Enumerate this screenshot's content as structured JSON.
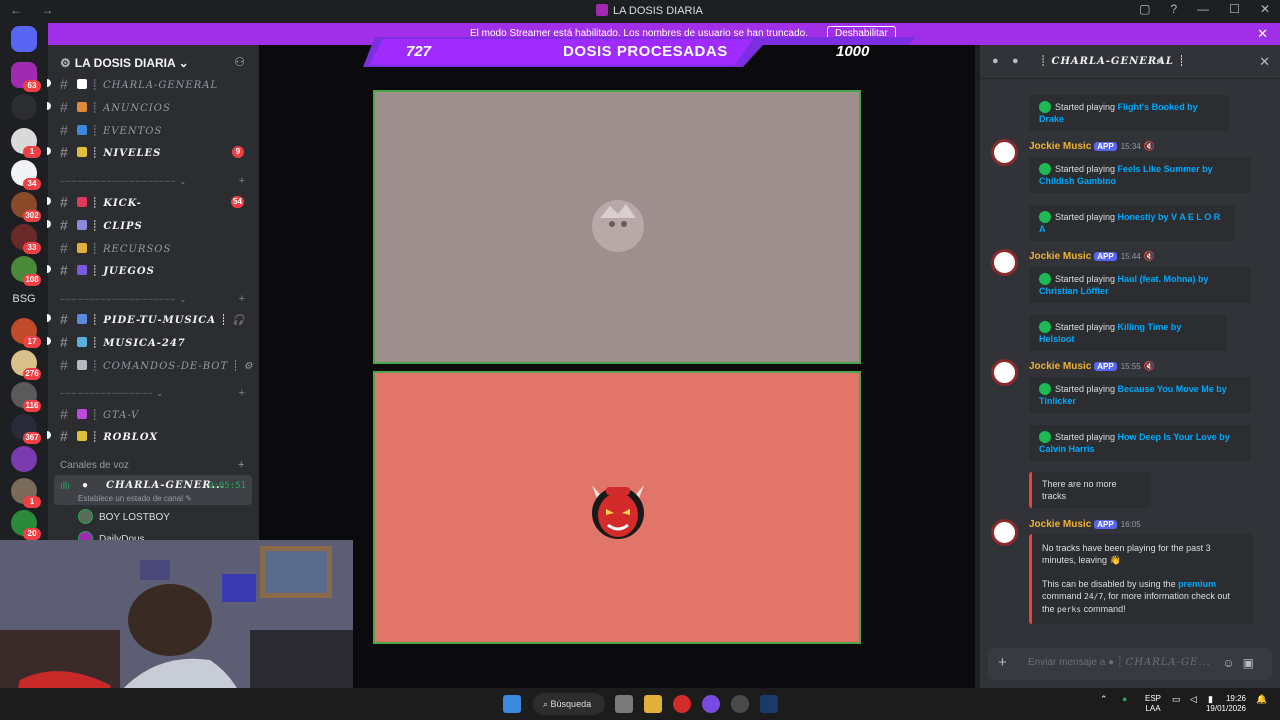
{
  "window": {
    "title": "LA DOSIS DIARIA",
    "nav": "← →",
    "controls": [
      "▢",
      "?",
      "—",
      "☐",
      "✕"
    ]
  },
  "banner": {
    "text": "El modo Streamer está habilitado. Los nombres de usuario se han truncado.",
    "button": "Deshabilitar",
    "close": "✕"
  },
  "servers": [
    {
      "badge": "63"
    },
    {
      "badge": ""
    },
    {
      "badge": "1"
    },
    {
      "badge": "34"
    },
    {
      "badge": "302"
    },
    {
      "badge": "33"
    },
    {
      "badge": "108"
    },
    {
      "label": "BSG"
    },
    {
      "badge": "17"
    },
    {
      "badge": "276"
    },
    {
      "badge": "116"
    },
    {
      "badge": "367"
    },
    {
      "badge": ""
    },
    {
      "badge": "1"
    },
    {
      "badge": "20"
    }
  ],
  "sidebar": {
    "server_name": "LA DOSIS DIARIA",
    "channels": [
      {
        "label": "CHARLA-GENERAL",
        "bold": false,
        "count": ""
      },
      {
        "label": "ANUNCIOS",
        "bold": false,
        "count": ""
      },
      {
        "label": "EVENTOS",
        "bold": false,
        "count": ""
      },
      {
        "label": "NIVELES",
        "bold": true,
        "count": "9"
      },
      {
        "label": "KICK-",
        "bold": true,
        "count": "54"
      },
      {
        "label": "CLIPS",
        "bold": true,
        "count": ""
      },
      {
        "label": "RECURSOS",
        "bold": false,
        "count": ""
      },
      {
        "label": "JUEGOS",
        "bold": true,
        "count": ""
      },
      {
        "label": "PIDE-TU-MUSICA",
        "bold": true,
        "count": ""
      },
      {
        "label": "MUSICA-247",
        "bold": true,
        "count": ""
      },
      {
        "label": "COMANDOS-DE-BOT",
        "bold": false,
        "count": ""
      },
      {
        "label": "GTA-V",
        "bold": false,
        "count": ""
      },
      {
        "label": "ROBLOX",
        "bold": true,
        "count": ""
      }
    ],
    "voice_label": "Canales de voz",
    "voice_active": {
      "name": "CHARLA-GENER...",
      "time": "9:05:51",
      "status": "Establece un estado de canal"
    },
    "voice_users": [
      "BOY LOSTBOY",
      "DailyDous"
    ]
  },
  "overlay": {
    "count": "727",
    "title": "DOSIS PROCESADAS",
    "goal": "1000"
  },
  "chat": {
    "channel": "CHARLA-GENERAL",
    "input_placeholder": "Enviar mensaje a",
    "input_channel": "CHARLA-GE...",
    "embeds": [
      {
        "prefix": "Started playing ",
        "link": "Flight's Booked by Drake"
      },
      {
        "prefix": "Started playing ",
        "link": "Feels Like Summer by Childish Gambino"
      },
      {
        "prefix": "Started playing ",
        "link": "Honestly by V A E L O R A"
      },
      {
        "prefix": "Started playing ",
        "link": "Haul (feat. Mohna) by Christian Löffler"
      },
      {
        "prefix": "Started playing ",
        "link": "Killing Time by Helsloot"
      },
      {
        "prefix": "Started playing ",
        "link": "Because You Move Me by Tinlicker"
      },
      {
        "prefix": "Started playing ",
        "link": "How Deep Is Your Love by Calvin Harris"
      }
    ],
    "messages": [
      {
        "author": "Jockie Music",
        "app": "APP",
        "time": "15:34"
      },
      {
        "author": "Jockie Music",
        "app": "APP",
        "time": "15:44"
      },
      {
        "author": "Jockie Music",
        "app": "APP",
        "time": "15:55"
      },
      {
        "author": "Jockie Music",
        "app": "APP",
        "time": "16:05"
      }
    ],
    "no_more": "There are no more tracks",
    "final": {
      "line1": "No tracks have been playing for the past 3 minutes, leaving 👋",
      "line2a": "This can be disabled by using the ",
      "premium": "premium",
      "line2b": " command ",
      "cmd247": "24/7",
      "line2c": ", for more information check out the ",
      "perks": "perks",
      "line2d": " command!"
    }
  },
  "taskbar": {
    "search": "Búsqueda",
    "lang1": "ESP",
    "lang2": "LAA",
    "time": "19:26",
    "date": "19/01/2026"
  }
}
